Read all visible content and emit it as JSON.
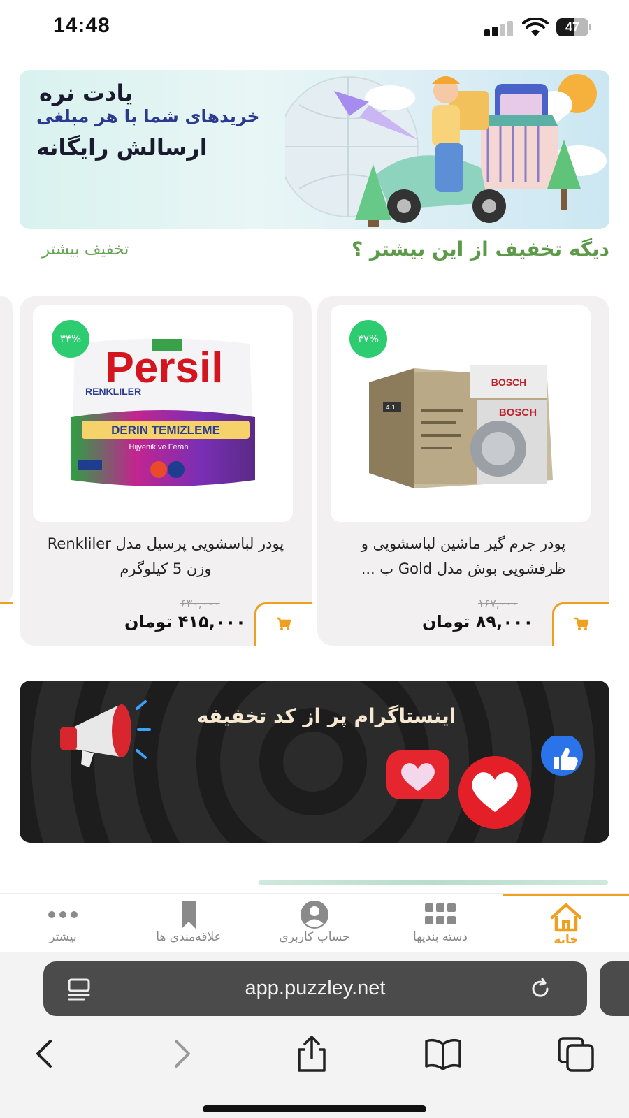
{
  "status": {
    "time": "14:48",
    "battery": "47"
  },
  "hero_banner": {
    "line1": "یادت نره",
    "line2": "خریدهای شما با هر مبلغی",
    "line3": "ارسالش رایگانه"
  },
  "section": {
    "title": "دیگه تخفیف از این بیشتر ؟",
    "more_link": "تخفیف بیشتر"
  },
  "products": [
    {
      "title": "پودر جرم گیر ماشین لباسشویی و ظرفشویی بوش مدل Gold ب ...",
      "discount": "۴۷%",
      "old_price": "۱۶۷,۰۰۰",
      "price": "۸۹,۰۰۰ تومان",
      "image": "bosch-cleaner-box"
    },
    {
      "title": "پودر لباسشویی پرسیل مدل Renkliler وزن 5 کیلوگرم",
      "discount": "۳۴%",
      "old_price": "۶۳۰,۰۰۰",
      "price": "۴۱۵,۰۰۰ تومان",
      "image": "persil-detergent-bag"
    }
  ],
  "promo_banner": {
    "text": "اینستاگرام پر از کد تخفیفه"
  },
  "tabbar": {
    "items": [
      {
        "label": "خانه",
        "icon": "home-icon",
        "active": true
      },
      {
        "label": "دسته بندیها",
        "icon": "grid-icon",
        "active": false
      },
      {
        "label": "حساب کاربری",
        "icon": "user-icon",
        "active": false
      },
      {
        "label": "علاقه‌مندی ها",
        "icon": "bookmark-icon",
        "active": false
      },
      {
        "label": "بیشتر",
        "icon": "more-icon",
        "active": false
      }
    ]
  },
  "browser": {
    "url": "app.puzzley.net"
  },
  "colors": {
    "accent": "#f0a020",
    "green": "#5c9a4a",
    "badge": "#2ecc71"
  }
}
